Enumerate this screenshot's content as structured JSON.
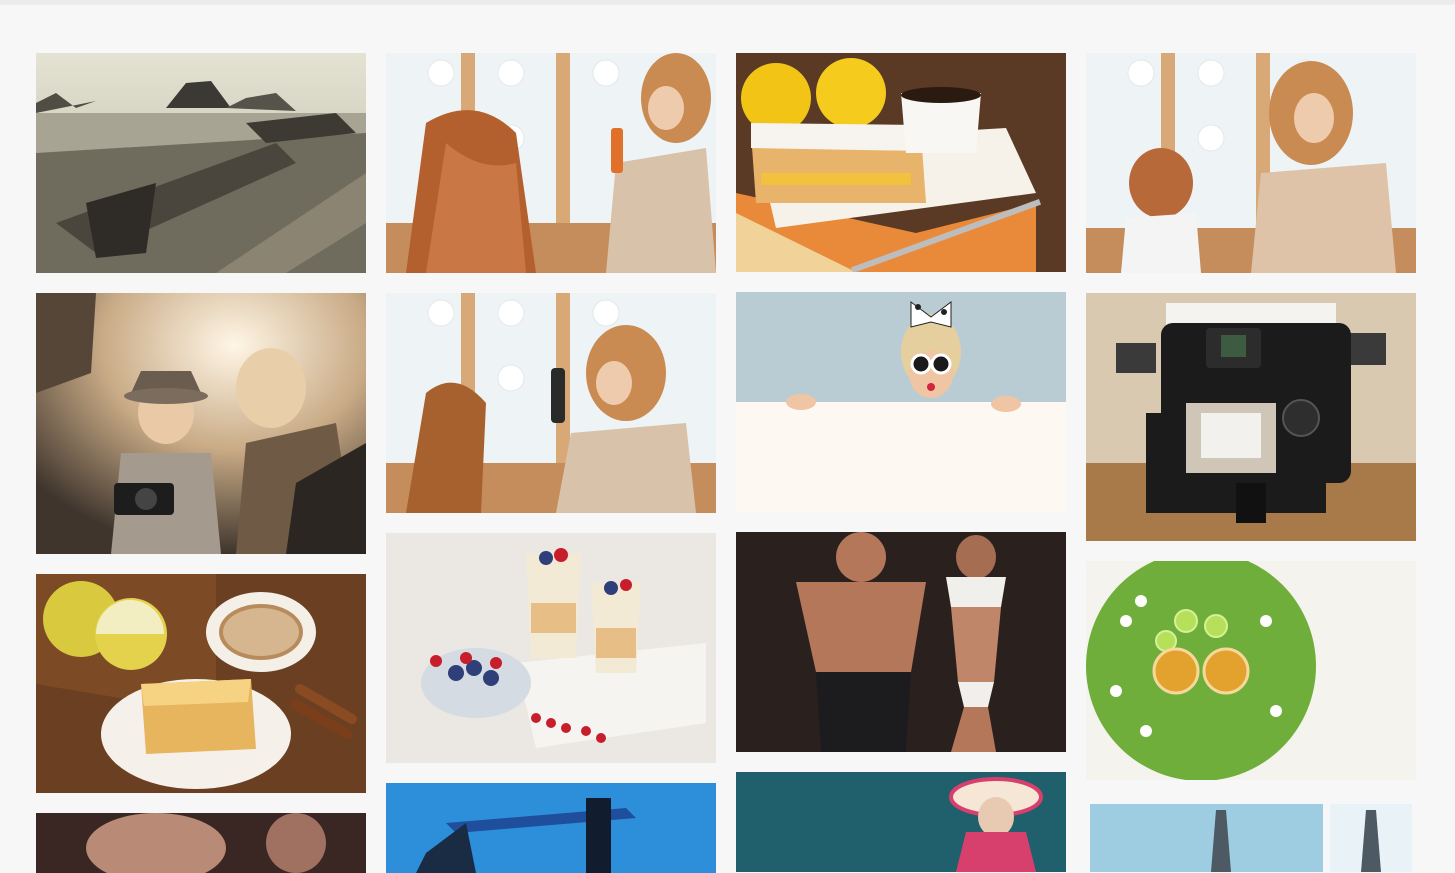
{
  "page": {
    "background": "#f7f7f7"
  },
  "gallery": {
    "columns": [
      {
        "items": [
          {
            "subject": "driftwood-beach-photo",
            "palette": [
              "#d8d6c4",
              "#6d6a5c",
              "#3b3a33"
            ]
          },
          {
            "subject": "child-photographer-photo",
            "palette": [
              "#e9d7b8",
              "#8c7a66",
              "#3d342c"
            ]
          },
          {
            "subject": "apples-coffee-cake-photo",
            "palette": [
              "#6b3f22",
              "#d9c84a",
              "#f3e7d2"
            ]
          },
          {
            "subject": "fitness-portrait-photo",
            "palette": [
              "#3a2723",
              "#b98b76",
              "#1c1412"
            ]
          }
        ]
      },
      {
        "items": [
          {
            "subject": "hairdresser-spray-photo",
            "palette": [
              "#eef4f6",
              "#c98b52",
              "#b3602e"
            ]
          },
          {
            "subject": "hairdresser-hairspray-photo",
            "palette": [
              "#eef4f6",
              "#c98b52",
              "#a7612f"
            ]
          },
          {
            "subject": "berry-dessert-glasses-photo",
            "palette": [
              "#ebe8e3",
              "#c81d2a",
              "#2f3f7a"
            ]
          },
          {
            "subject": "construction-crane-photo",
            "palette": [
              "#2d8fd9",
              "#1f4f9c",
              "#111d2f"
            ]
          }
        ]
      },
      {
        "items": [
          {
            "subject": "lemon-cake-coffee-photo",
            "palette": [
              "#5a3a24",
              "#f2c416",
              "#f3ede0"
            ]
          },
          {
            "subject": "woman-peeking-over-board-photo",
            "palette": [
              "#b9cbd3",
              "#fdf8f2",
              "#e6b78f"
            ]
          },
          {
            "subject": "fitness-couple-photo",
            "palette": [
              "#2a211f",
              "#b4775a",
              "#f0efec"
            ]
          },
          {
            "subject": "woman-in-sunhat-photo",
            "palette": [
              "#205f6c",
              "#e8c9b1",
              "#d7406c"
            ]
          }
        ]
      },
      {
        "items": [
          {
            "subject": "hairdresser-styling-photo",
            "palette": [
              "#eef4f6",
              "#b8693a",
              "#dec3a9"
            ]
          },
          {
            "subject": "camera-studio-photo",
            "palette": [
              "#d9c9b0",
              "#1b1b1b",
              "#6b4a2b"
            ]
          },
          {
            "subject": "lime-tea-green-tray-photo",
            "palette": [
              "#6fae3a",
              "#f4f3ee",
              "#e3a12d"
            ]
          },
          {
            "subject": "industrial-tower-photo",
            "palette": [
              "#9ecde2",
              "#e9f2f6",
              "#4d5a63"
            ]
          }
        ]
      }
    ]
  }
}
